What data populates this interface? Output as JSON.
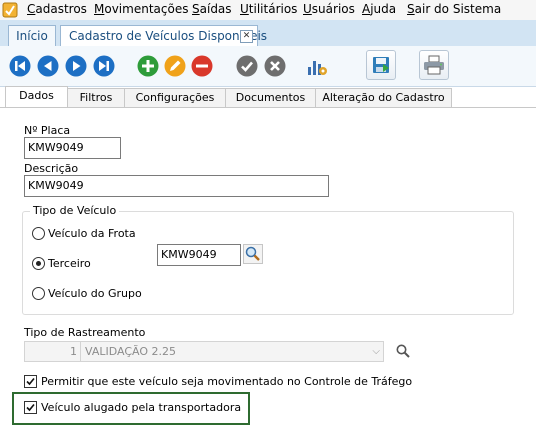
{
  "menu": {
    "items": [
      {
        "accel": "C",
        "rest": "adastros"
      },
      {
        "accel": "M",
        "rest": "ovimentações"
      },
      {
        "accel": "S",
        "rest": "aídas"
      },
      {
        "accel": "U",
        "rest": "tilitários"
      },
      {
        "accel": "U",
        "rest": "suários"
      },
      {
        "accel": "A",
        "rest": "juda"
      },
      {
        "accel": "S",
        "rest": "air do Sistema"
      }
    ]
  },
  "doc_tabs": {
    "home": "Início",
    "current": "Cadastro de Veículos Disponíveis",
    "close_glyph": "✕"
  },
  "toolbar": {
    "icons": [
      "first-icon",
      "previous-icon",
      "next-icon",
      "last-icon",
      "add-icon",
      "edit-icon",
      "delete-icon",
      "confirm-icon",
      "cancel-icon",
      "report-icon",
      "save-export-icon",
      "print-icon"
    ]
  },
  "sub_tabs": [
    "Dados",
    "Filtros",
    "Configurações",
    "Documentos",
    "Alteração do Cadastro"
  ],
  "form": {
    "placa_label": "Nº Placa",
    "placa_value": "KMW9049",
    "descricao_label": "Descrição",
    "descricao_value": "KMW9049",
    "tipo_veiculo_label": "Tipo de Veículo",
    "radio_frota": "Veículo da Frota",
    "radio_terceiro": "Terceiro",
    "radio_grupo": "Veículo do Grupo",
    "selected_radio": "Terceiro",
    "terceiro_value": "KMW9049",
    "rastreamento_label": "Tipo de Rastreamento",
    "rastreamento_code": "1",
    "rastreamento_value": "VALIDAÇÃO 2.25",
    "combo_arrow": "⌵",
    "check_controle": "Permitir que este veículo seja movimentado no Controle de Tráfego",
    "check_alugado": "Veículo alugado pela transportadora",
    "check_controle_checked": true,
    "check_alugado_checked": true
  },
  "colors": {
    "nav_blue": "#1d6fc4",
    "add_green": "#2e9c3a",
    "edit_orange": "#f0a21a",
    "delete_red": "#d9382b",
    "neutral_gray": "#6e6e6e",
    "highlight_green": "#2e6b30"
  }
}
